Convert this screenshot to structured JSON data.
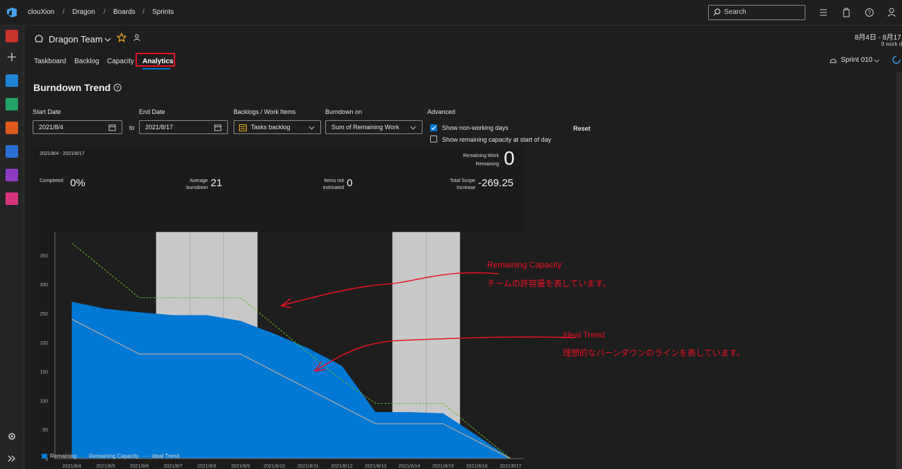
{
  "breadcrumb": [
    "clouXion",
    "Dragon",
    "Boards",
    "Sprints"
  ],
  "search": {
    "placeholder": "Search"
  },
  "team": {
    "name": "Dragon Team"
  },
  "tabs": [
    "Taskboard",
    "Backlog",
    "Capacity",
    "Analytics"
  ],
  "active_tab": "Analytics",
  "sprint_dates": "8月4日 - 8月17",
  "work_days": "9 work d",
  "sprint_selector": "Sprint 010",
  "page_title": "Burndown Trend",
  "filters": {
    "start_date_label": "Start Date",
    "start_date": "2021/8/4",
    "to_label": "to",
    "end_date_label": "End Date",
    "end_date": "2021/8/17",
    "backlog_label": "Backlogs / Work Items",
    "backlog_value": "Tasks backlog",
    "burndown_on_label": "Burndown on",
    "burndown_on_value": "Sum of Remaining Work",
    "advanced_label": "Advanced",
    "show_nonworking": "Show non-working days",
    "show_nonworking_checked": true,
    "show_capacity": "Show remaining capacity at start of day",
    "show_capacity_checked": false,
    "reset_label": "Reset"
  },
  "summary": {
    "range": "2021/8/4 - 2021/8/17",
    "remaining_work_label_1": "Remaining Work",
    "remaining_work_label_2": "Remaining",
    "remaining_work_value": "0",
    "completed_label": "Completed",
    "completed_value": "0%",
    "avg_label_1": "Average",
    "avg_label_2": "burndown",
    "avg_value": "21",
    "items_label_1": "Items not",
    "items_label_2": "estimated",
    "items_value": "0",
    "scope_label_1": "Total Scope",
    "scope_label_2": "Increase",
    "scope_value": "-269.25"
  },
  "annotations": {
    "capacity_title": "Remaining Capacity",
    "capacity_text": "チームの許容量を表しています。",
    "ideal_title": "Ideal Trend",
    "ideal_text": "理想的なバーンダウンのラインを表しています。"
  },
  "colors": {
    "remaining": "#0078d4",
    "capacity": "#6ab830",
    "ideal": "#a8a8a8",
    "nonworking": "#c8c8c8",
    "annotation": "#e81123",
    "accent": "#0078d4"
  },
  "chart_data": {
    "type": "area",
    "categories": [
      "2021/8/4",
      "2021/8/5",
      "2021/8/6",
      "2021/8/7",
      "2021/8/8",
      "2021/8/9",
      "2021/8/10",
      "2021/8/11",
      "2021/8/12",
      "2021/8/13",
      "2021/8/14",
      "2021/8/15",
      "2021/8/16",
      "2021/8/17"
    ],
    "ylim": [
      0,
      390
    ],
    "yticks": [
      0,
      50,
      100,
      150,
      200,
      250,
      300,
      350
    ],
    "nonworking_days": [
      "2021/8/7",
      "2021/8/8",
      "2021/8/9",
      "2021/8/14",
      "2021/8/15"
    ],
    "series": [
      {
        "name": "Remaining",
        "values": [
          270,
          258,
          252,
          247,
          247,
          237,
          215,
          190,
          160,
          80,
          80,
          78,
          40,
          0
        ]
      },
      {
        "name": "Remaining Capacity",
        "values": [
          371,
          324,
          277,
          277,
          277,
          277,
          230,
          182,
          135,
          95,
          95,
          95,
          47,
          0
        ]
      },
      {
        "name": "Ideal Trend",
        "values": [
          240,
          210,
          180,
          180,
          180,
          180,
          150,
          120,
          90,
          60,
          60,
          60,
          30,
          0
        ]
      }
    ]
  }
}
